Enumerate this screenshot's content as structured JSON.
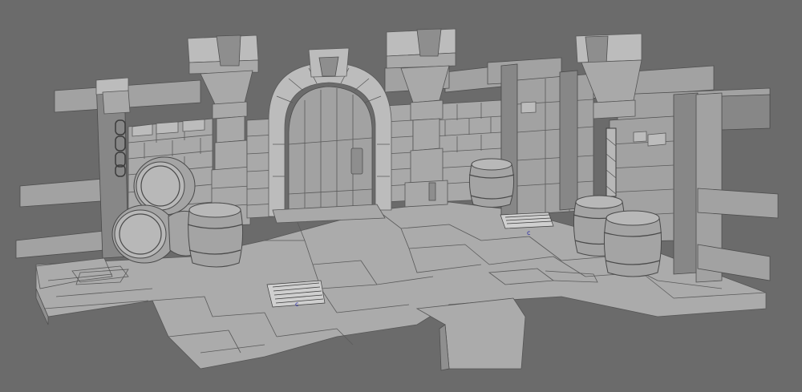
{
  "viewport": {
    "background_color": "#6b6b6b",
    "model_color": "#a9a9a9"
  },
  "scene": {
    "objects": [
      {
        "name": "floor",
        "icon": "stone-floor"
      },
      {
        "name": "back-wall",
        "icon": "brick-wall"
      },
      {
        "name": "arched-door",
        "icon": "door"
      },
      {
        "name": "pillars",
        "count": 3
      },
      {
        "name": "barrels",
        "count": 7
      },
      {
        "name": "floor-grates",
        "count": 2
      },
      {
        "name": "wooden-frame",
        "icon": "timber-frame"
      },
      {
        "name": "hanging-chains",
        "count": 2
      }
    ]
  },
  "pivot_markers": [
    "c",
    "c"
  ]
}
